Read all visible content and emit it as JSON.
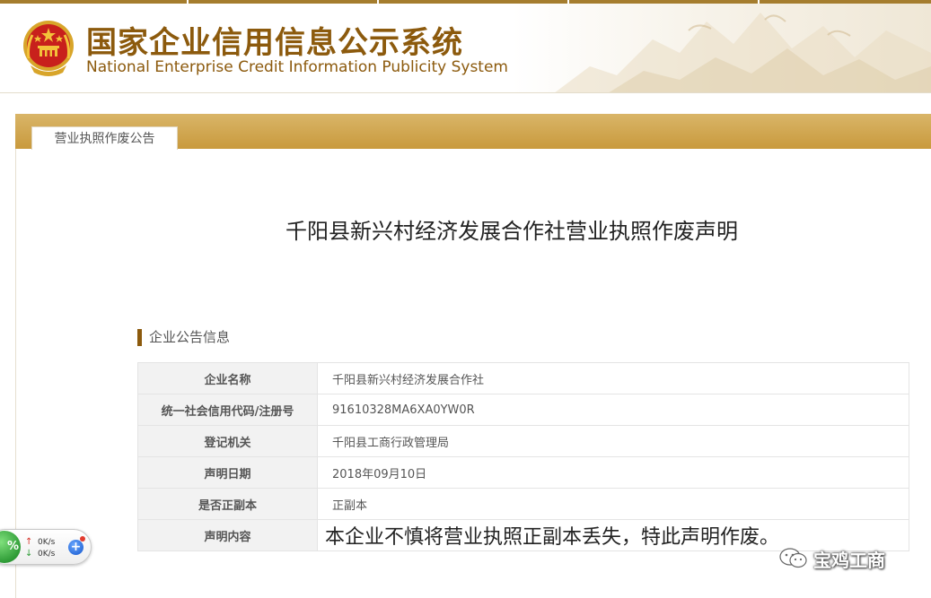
{
  "header": {
    "title_cn": "国家企业信用信息公示系统",
    "title_en": "National Enterprise Credit Information Publicity System"
  },
  "tab": {
    "label": "营业执照作废公告"
  },
  "notice": {
    "title": "千阳县新兴村经济发展合作社营业执照作废声明",
    "section_label": "企业公告信息",
    "rows": [
      {
        "key": "企业名称",
        "value": "千阳县新兴村经济发展合作社"
      },
      {
        "key": "统一社会信用代码/注册号",
        "value": "91610328MA6XA0YW0R"
      },
      {
        "key": "登记机关",
        "value": "千阳县工商行政管理局"
      },
      {
        "key": "声明日期",
        "value": "2018年09月10日"
      },
      {
        "key": "是否正副本",
        "value": "正副本"
      },
      {
        "key": "声明内容",
        "value": "本企业不慎将营业执照正副本丢失，特此声明作废。"
      }
    ]
  },
  "watermark": {
    "text": "宝鸡工商"
  },
  "net_widget": {
    "percent": "%",
    "up_rate": "0K/s",
    "down_rate": "0K/s",
    "plus": "+"
  },
  "colors": {
    "brand_gold": "#8c5a0d",
    "tabbar": "#c99a3d",
    "table_key_bg": "#f2f2f2"
  },
  "icons": {
    "emblem": "national-emblem-icon",
    "watermark": "wechat-icon"
  }
}
